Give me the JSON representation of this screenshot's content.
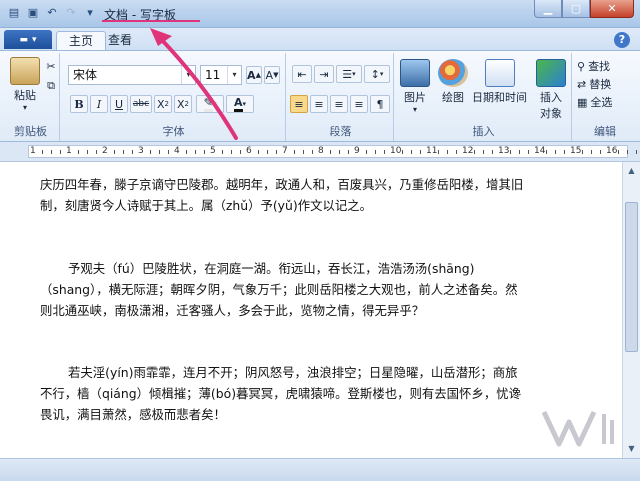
{
  "window": {
    "title": "文档 - 写字板"
  },
  "tabs": [
    {
      "label": "主页"
    },
    {
      "label": "查看"
    }
  ],
  "ribbon": {
    "clipboard": {
      "label": "剪贴板",
      "paste": "粘贴"
    },
    "font": {
      "label": "字体",
      "family": "宋体",
      "size": "11"
    },
    "paragraph": {
      "label": "段落"
    },
    "insert": {
      "label": "插入",
      "picture": "图片",
      "paint": "绘图",
      "datetime": "日期和时间",
      "object_line1": "插入",
      "object_line2": "对象"
    },
    "edit": {
      "label": "编辑",
      "find": "查找",
      "replace": "替换",
      "select_all": "全选"
    }
  },
  "ruler": {
    "numbers": [
      "1",
      "1",
      "2",
      "3",
      "4",
      "5",
      "6",
      "7",
      "8",
      "9",
      "10",
      "11",
      "12",
      "13",
      "14",
      "15",
      "16"
    ]
  },
  "document": {
    "paragraphs": [
      [
        "庆历四年春，滕子京谪守巴陵郡。越明年，政通人和，百废具兴，乃重修岳阳楼，增其旧",
        "制，刻唐贤今人诗赋于其上。属（zhǔ）予(yǔ)作文以记之。"
      ],
      [
        "予观夫（fú）巴陵胜状，在洞庭一湖。衔远山，吞长江，浩浩汤汤(shāng)",
        "（shang），横无际涯；朝晖夕阴，气象万千；此则岳阳楼之大观也，前人之述备矣。然",
        "则北通巫峡，南极潇湘，迁客骚人，多会于此，览物之情，得无异乎？"
      ],
      [
        "若夫淫(yín)雨霏霏，连月不开；阴风怒号，浊浪排空；日星隐曜，山岳潜形；商旅",
        "不行，樯（qiáng）倾楫摧；薄(bó)暮冥冥，虎啸猿啼。登斯楼也，则有去国怀乡，忧谗",
        "畏讥，满目萧然，感极而悲者矣！"
      ]
    ]
  },
  "colors": {
    "annotation_arrow": "#e0347a",
    "title_highlight": "#e0347a"
  }
}
